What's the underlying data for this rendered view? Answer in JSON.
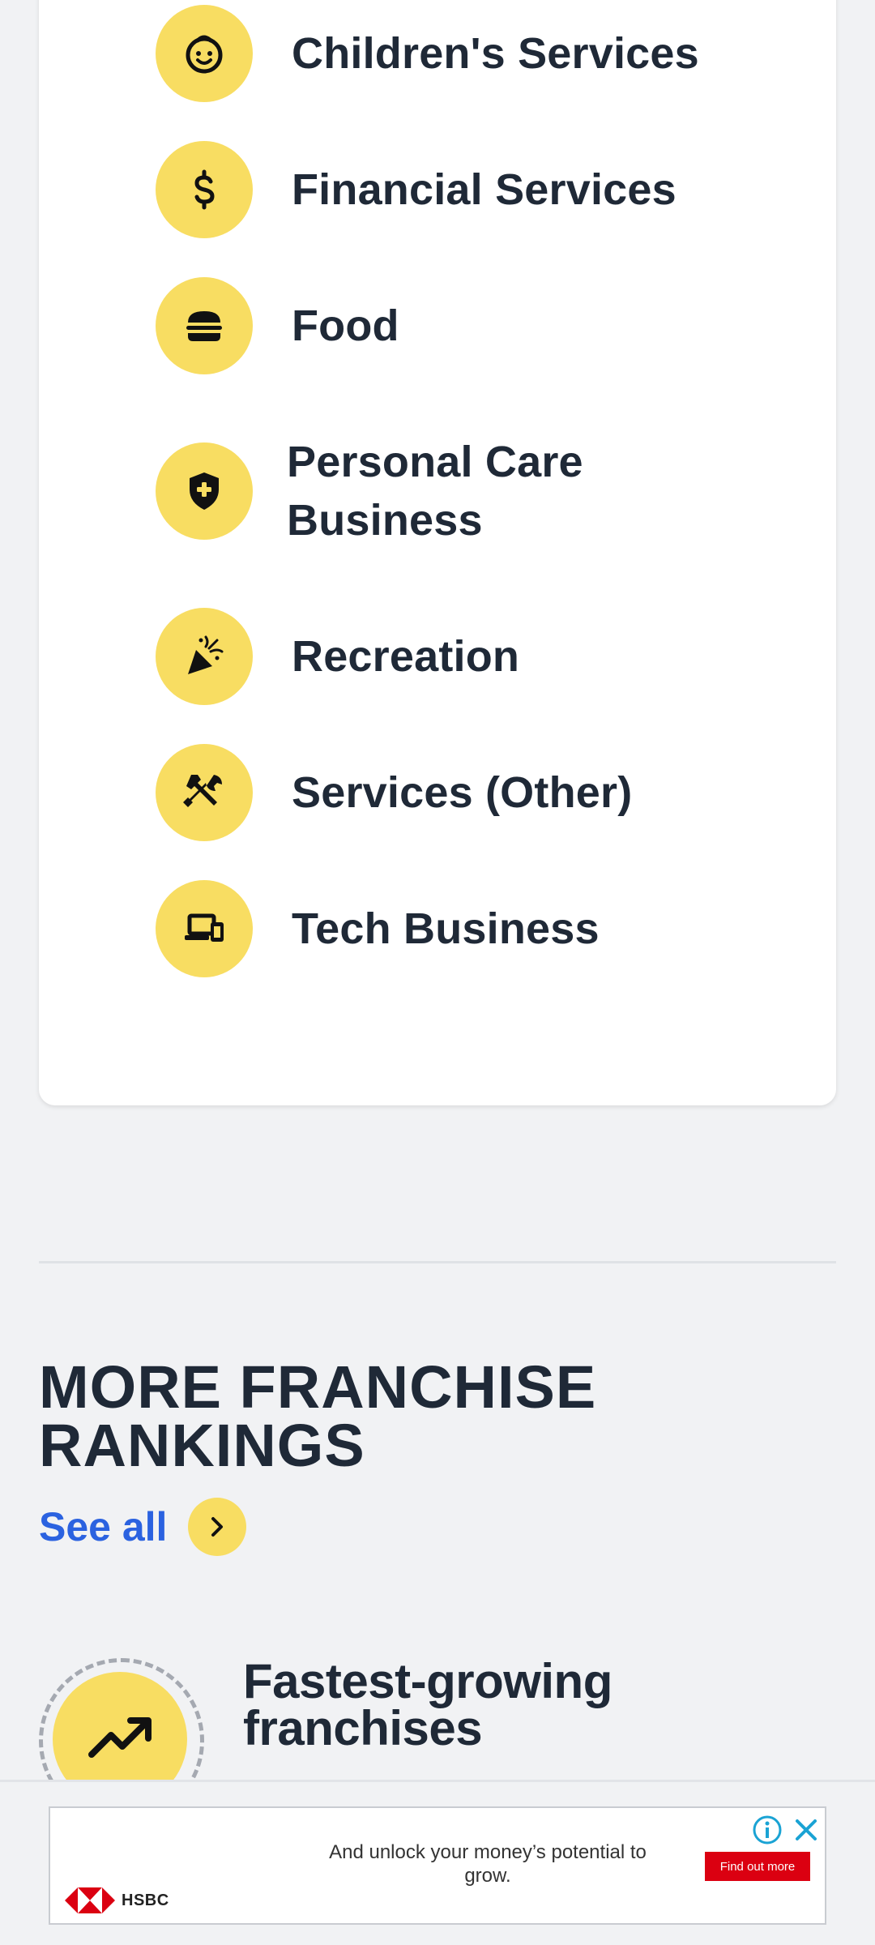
{
  "categories": [
    {
      "label": "Children's Services",
      "icon": "child-face-icon"
    },
    {
      "label": "Financial Services",
      "icon": "dollar-icon"
    },
    {
      "label": "Food",
      "icon": "burger-icon"
    },
    {
      "label": "Personal Care Business",
      "icon": "shield-plus-icon"
    },
    {
      "label": "Recreation",
      "icon": "party-popper-icon"
    },
    {
      "label": "Services (Other)",
      "icon": "tools-icon"
    },
    {
      "label": "Tech Business",
      "icon": "devices-icon"
    }
  ],
  "more_rankings": {
    "title": "MORE FRANCHISE RANKINGS",
    "see_all_label": "See all",
    "items": [
      {
        "title": "Fastest-growing franchises",
        "icon": "trending-up-icon"
      }
    ]
  },
  "ad": {
    "text": "And unlock your money’s potential to grow.",
    "cta_label": "Find out more",
    "brand": "HSBC"
  },
  "colors": {
    "accent_yellow": "#f8dd62",
    "link_blue": "#2b62e0",
    "text_dark": "#1f2937",
    "ad_red": "#db0011"
  }
}
